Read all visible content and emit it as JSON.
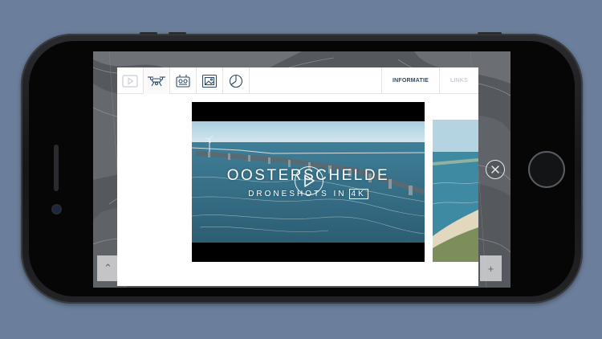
{
  "app": {
    "toolbar": {
      "tools": [
        {
          "icon": "play-video-icon"
        },
        {
          "icon": "drone-icon"
        },
        {
          "icon": "radio-device-icon"
        },
        {
          "icon": "image-gallery-icon"
        },
        {
          "icon": "pie-chart-icon"
        }
      ],
      "tab_info": "INFORMATIE",
      "tab_links": "LINKS"
    },
    "video": {
      "title": "OOSTERSCHELDE",
      "subtitle_prefix": "DRONESHOTS IN",
      "subtitle_boxed": "4K"
    },
    "buttons": {
      "close_icon": "close-icon",
      "up_symbol": "⌃",
      "plus_symbol": "+"
    }
  },
  "colors": {
    "background": "#6b7f9c",
    "tab_active": "#2d4a66",
    "tab_inactive": "#c7cfd8"
  }
}
